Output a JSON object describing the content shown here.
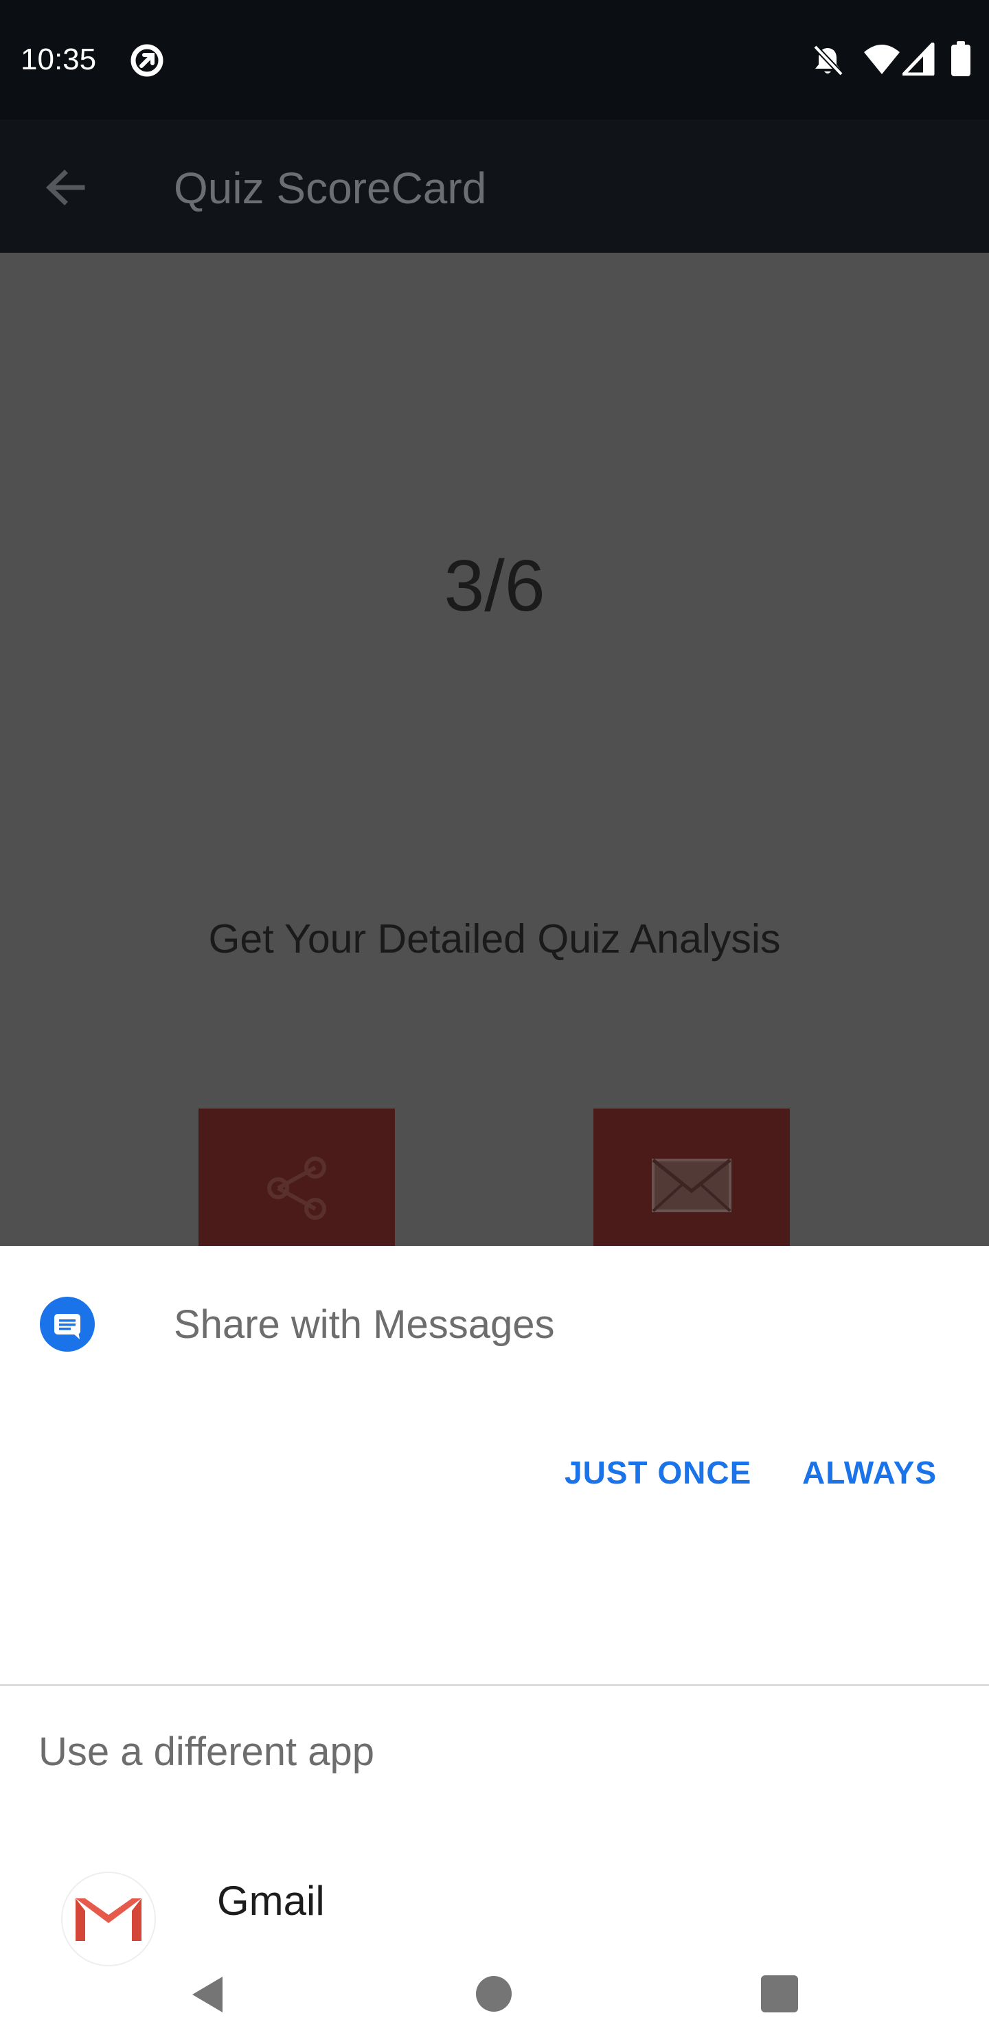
{
  "status_bar": {
    "time": "10:35"
  },
  "app_bar": {
    "title": "Quiz ScoreCard"
  },
  "content": {
    "score": "3/6",
    "analysis_text": "Get Your Detailed Quiz Analysis"
  },
  "share_sheet": {
    "title": "Share with Messages",
    "just_once_label": "JUST ONCE",
    "always_label": "ALWAYS",
    "different_app_label": "Use a different app",
    "apps": [
      {
        "name": "Gmail"
      }
    ]
  },
  "colors": {
    "accent": "#1a73e8",
    "scrim": "#505050",
    "action_tile": "#4a1b18",
    "status_bar": "#0b0e12"
  }
}
